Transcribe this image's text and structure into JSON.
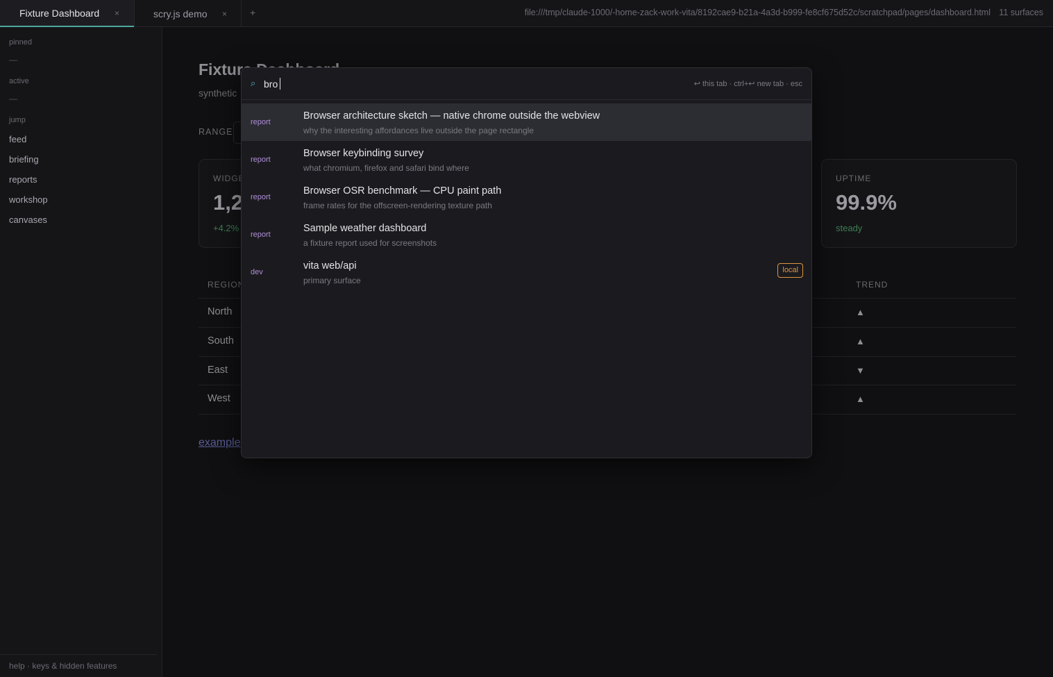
{
  "tabs": [
    {
      "title": "Fixture Dashboard",
      "close": "×"
    },
    {
      "title": "scry.js demo",
      "close": "×"
    }
  ],
  "new_tab": "+",
  "address": {
    "url": "file:///tmp/claude-1000/-home-zack-work-vita/8192cae9-b21a-4a3d-b999-fe8cf675d52c/scratchpad/pages/dashboard.html",
    "surfaces": "11 surfaces"
  },
  "sidebar": {
    "pinned_label": "pinned",
    "pinned_empty": "—",
    "active_label": "active",
    "active_empty": "—",
    "jump_label": "jump",
    "items": [
      {
        "label": "feed"
      },
      {
        "label": "briefing"
      },
      {
        "label": "reports"
      },
      {
        "label": "workshop"
      },
      {
        "label": "canvases"
      }
    ],
    "footer": "help · keys & hidden features"
  },
  "dashboard": {
    "title": "Fixture Dashboard",
    "subtitle": "synthetic",
    "range_label": "RANGE",
    "cards": [
      {
        "label": "WIDGE",
        "value": "1,2",
        "delta": "+4.2%"
      },
      {
        "label": "UPTIME",
        "value": "99.9%",
        "delta": "steady"
      }
    ],
    "columns": {
      "region": "REGION",
      "trend": "TREND"
    },
    "rows": [
      {
        "region": "North",
        "trend": "▲"
      },
      {
        "region": "South",
        "trend": "▲"
      },
      {
        "region": "East",
        "trend": "▼"
      },
      {
        "region": "West",
        "trend": "▲"
      }
    ],
    "link": "example"
  },
  "palette": {
    "search_icon": "⌕",
    "query": "bro",
    "hints": "↩ this tab  ·  ctrl+↩ new tab  ·  esc",
    "results": [
      {
        "kind": "report",
        "title": "Browser architecture sketch — native chrome outside the webview",
        "desc": "why the interesting affordances live outside the page rectangle"
      },
      {
        "kind": "report",
        "title": "Browser keybinding survey",
        "desc": "what chromium, firefox and safari bind where"
      },
      {
        "kind": "report",
        "title": "Browser OSR benchmark — CPU paint path",
        "desc": "frame rates for the offscreen-rendering texture path"
      },
      {
        "kind": "report",
        "title": "Sample weather dashboard",
        "desc": "a fixture report used for screenshots"
      },
      {
        "kind": "dev",
        "title": "vita web/api",
        "desc": "primary surface",
        "badge": "local"
      }
    ]
  },
  "colors": {
    "accent": "#4fa8a0",
    "kind": "#b08fd8",
    "badge": "#e0953f",
    "positive": "#3f7f52",
    "link": "#5a5c98"
  }
}
